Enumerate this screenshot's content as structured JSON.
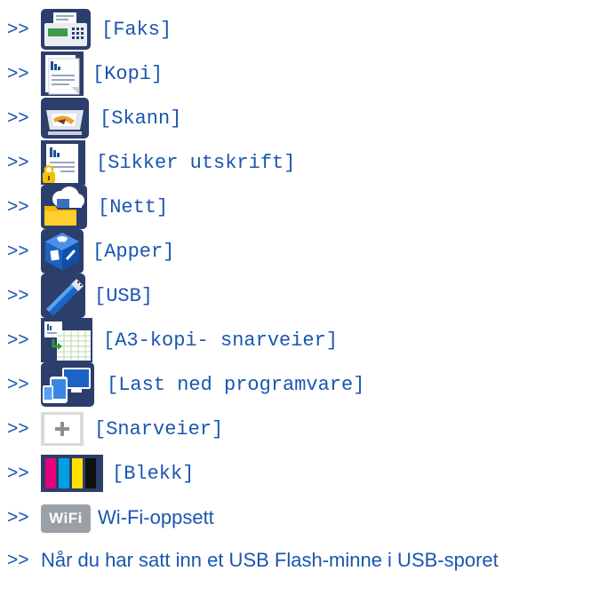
{
  "items": [
    {
      "arrow": ">>",
      "label": "[Faks]",
      "icon": "fax-icon"
    },
    {
      "arrow": ">>",
      "label": "[Kopi]",
      "icon": "copy-icon"
    },
    {
      "arrow": ">>",
      "label": "[Skann]",
      "icon": "scanner-icon"
    },
    {
      "arrow": ">>",
      "label": "[Sikker utskrift]",
      "icon": "secure-print-icon"
    },
    {
      "arrow": ">>",
      "label": "[Nett]",
      "icon": "web-icon"
    },
    {
      "arrow": ">>",
      "label": "[Apper]",
      "icon": "apps-icon"
    },
    {
      "arrow": ">>",
      "label": "[USB]",
      "icon": "usb-icon"
    },
    {
      "arrow": ">>",
      "label": "[A3-kopi- snarveier]",
      "icon": "a3-copy-shortcuts-icon"
    },
    {
      "arrow": ">>",
      "label": "[Last ned programvare]",
      "icon": "download-software-icon"
    },
    {
      "arrow": ">>",
      "label": "[Snarveier]",
      "icon": "shortcuts-plus-icon"
    },
    {
      "arrow": ">>",
      "label": "[Blekk]",
      "icon": "ink-icon"
    },
    {
      "arrow": ">>",
      "label": "Wi-Fi-oppsett",
      "icon": "wifi-icon",
      "icon_text": "WiFi"
    },
    {
      "arrow": ">>",
      "label": "Når du har satt inn et USB Flash-minne i USB-sporet",
      "icon": ""
    }
  ],
  "colors": {
    "link": "#1a56b0",
    "ink_magenta": "#e6007e",
    "ink_cyan": "#00a0e0",
    "ink_yellow": "#ffe000",
    "ink_black": "#111111"
  }
}
